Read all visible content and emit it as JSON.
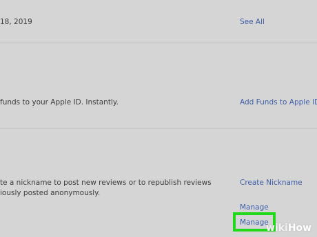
{
  "rows": [
    {
      "text": " 18, 2019",
      "link": "See All"
    },
    {
      "text": "funds to your Apple ID. Instantly.",
      "link": "Add Funds to Apple ID"
    },
    {
      "text_line1": "te a nickname to post new reviews or to republish reviews",
      "text_line2": "iously posted anonymously.",
      "link": "Create Nickname"
    }
  ],
  "manage_links": [
    "Manage",
    "Manage"
  ],
  "watermark": {
    "part1": "wiki",
    "part2": "How"
  },
  "colors": {
    "background": "#d5d5d5",
    "link": "#3d5ea8",
    "highlight": "#22d81b"
  }
}
